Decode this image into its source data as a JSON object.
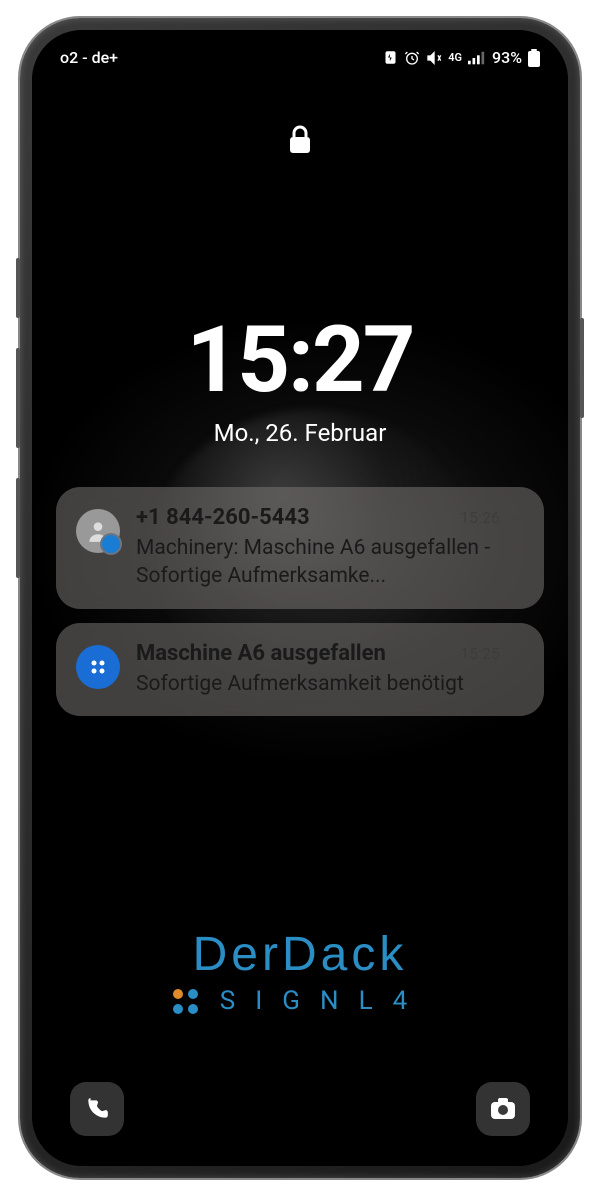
{
  "statusBar": {
    "carrier": "o2 - de+",
    "batteryPercent": "93%",
    "networkType": "4G"
  },
  "clock": {
    "time": "15:27",
    "date": "Mo., 26. Februar"
  },
  "notifications": [
    {
      "iconType": "contact",
      "title": "+1 844-260-5443",
      "time": "15:26",
      "body": "Machinery: Maschine A6 ausgefallen - Sofortige Aufmerksamke..."
    },
    {
      "iconType": "app",
      "title": "Maschine A6 ausgefallen",
      "time": "15:25",
      "body": "Sofortige Aufmerksamkeit benötigt"
    }
  ],
  "brand": {
    "main": "DerDack",
    "sub": "SIGNL4"
  }
}
